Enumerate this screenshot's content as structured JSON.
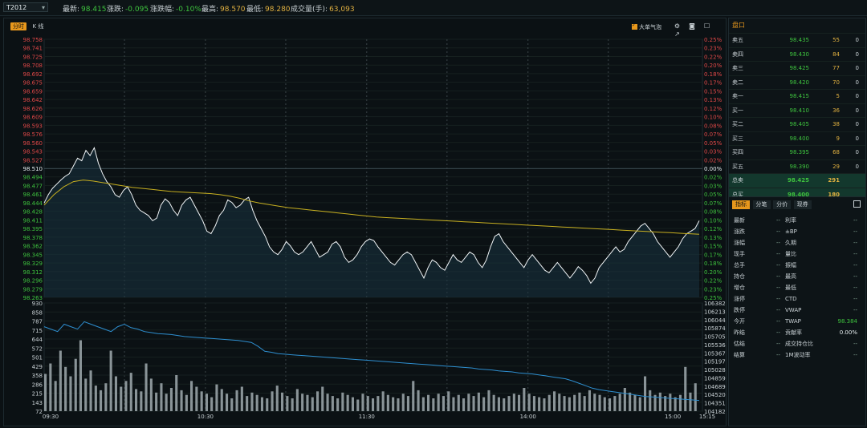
{
  "header": {
    "symbol": "T2012",
    "items": [
      {
        "label": "最新:",
        "value": "98.415",
        "color": "green"
      },
      {
        "label": "涨跌:",
        "value": "-0.095",
        "color": "green"
      },
      {
        "label": "涨跌幅:",
        "value": "-0.10%",
        "color": "green"
      },
      {
        "label": "最高:",
        "value": "98.570",
        "color": "yellow"
      },
      {
        "label": "最低:",
        "value": "98.280",
        "color": "yellow"
      },
      {
        "label": "成交量(手):",
        "value": "63,093",
        "color": "yellow"
      }
    ]
  },
  "chart_toolbar": {
    "tabs": [
      "分时",
      "K 线"
    ],
    "active_tab": 0,
    "bigorder_label": "大单气泡",
    "icons": [
      "gear-icon",
      "camera-icon",
      "square-icon",
      "external-link-icon"
    ]
  },
  "chart_data": {
    "type": "line",
    "ylim": [
      98.263,
      98.758
    ],
    "y_ticks": [
      "98.758",
      "98.741",
      "98.725",
      "98.708",
      "98.692",
      "98.675",
      "98.659",
      "98.642",
      "98.626",
      "98.609",
      "98.593",
      "98.576",
      "98.560",
      "98.543",
      "98.527",
      "98.510",
      "98.494",
      "98.477",
      "98.461",
      "98.444",
      "98.428",
      "98.411",
      "98.395",
      "98.378",
      "98.362",
      "98.345",
      "98.329",
      "98.312",
      "98.296",
      "98.279",
      "98.263"
    ],
    "right_pct_ticks": [
      "0.25%",
      "0.23%",
      "0.22%",
      "0.20%",
      "0.18%",
      "0.17%",
      "0.15%",
      "0.13%",
      "0.12%",
      "0.10%",
      "0.08%",
      "0.07%",
      "0.05%",
      "0.03%",
      "0.02%",
      "0.00%",
      "0.02%",
      "0.03%",
      "0.05%",
      "0.07%",
      "0.08%",
      "0.10%",
      "0.12%",
      "0.13%",
      "0.15%",
      "0.17%",
      "0.18%",
      "0.20%",
      "0.22%",
      "0.23%",
      "0.25%"
    ],
    "ref_price": 98.51,
    "x_labels": [
      "09:30",
      "10:30",
      "11:30",
      "14:00",
      "15:00",
      "15:15"
    ],
    "price_series": [
      98.444,
      98.46,
      98.472,
      98.48,
      98.488,
      98.495,
      98.5,
      98.515,
      98.53,
      98.525,
      98.545,
      98.535,
      98.55,
      98.52,
      98.5,
      98.485,
      98.475,
      98.46,
      98.455,
      98.468,
      98.475,
      98.46,
      98.44,
      98.43,
      98.425,
      98.42,
      98.41,
      98.415,
      98.44,
      98.452,
      98.445,
      98.43,
      98.42,
      98.44,
      98.45,
      98.455,
      98.44,
      98.425,
      98.41,
      98.39,
      98.385,
      98.4,
      98.42,
      98.43,
      98.45,
      98.445,
      98.435,
      98.44,
      98.45,
      98.455,
      98.43,
      98.41,
      98.395,
      98.38,
      98.36,
      98.35,
      98.345,
      98.355,
      98.37,
      98.362,
      98.35,
      98.345,
      98.35,
      98.36,
      98.37,
      98.355,
      98.34,
      98.345,
      98.35,
      98.365,
      98.37,
      98.36,
      98.34,
      98.33,
      98.335,
      98.345,
      98.36,
      98.37,
      98.375,
      98.372,
      98.36,
      98.35,
      98.34,
      98.33,
      98.325,
      98.335,
      98.345,
      98.35,
      98.345,
      98.33,
      98.315,
      98.3,
      98.32,
      98.335,
      98.33,
      98.32,
      98.315,
      98.33,
      98.345,
      98.335,
      98.33,
      98.34,
      98.35,
      98.345,
      98.33,
      98.32,
      98.335,
      98.36,
      98.38,
      98.385,
      98.37,
      98.36,
      98.35,
      98.34,
      98.33,
      98.32,
      98.335,
      98.345,
      98.335,
      98.325,
      98.315,
      98.31,
      98.32,
      98.33,
      98.32,
      98.31,
      98.3,
      98.31,
      98.322,
      98.315,
      98.305,
      98.29,
      98.3,
      98.32,
      98.33,
      98.34,
      98.35,
      98.36,
      98.35,
      98.355,
      98.37,
      98.38,
      98.39,
      98.4,
      98.405,
      98.395,
      98.385,
      98.37,
      98.36,
      98.35,
      98.34,
      98.35,
      98.36,
      98.375,
      98.385,
      98.39,
      98.395,
      98.41
    ],
    "avg_series": [
      98.44,
      98.46,
      98.475,
      98.485,
      98.488,
      98.486,
      98.483,
      98.48,
      98.477,
      98.474,
      98.472,
      98.47,
      98.468,
      98.466,
      98.465,
      98.464,
      98.463,
      98.462,
      98.46,
      98.457,
      98.453,
      98.448,
      98.444,
      98.441,
      98.438,
      98.435,
      98.433,
      98.431,
      98.429,
      98.427,
      98.425,
      98.423,
      98.421,
      98.419,
      98.417,
      98.416,
      98.415,
      98.414,
      98.413,
      98.412,
      98.411,
      98.41,
      98.409,
      98.408,
      98.407,
      98.406,
      98.405,
      98.404,
      98.403,
      98.402,
      98.401,
      98.4,
      98.399,
      98.398,
      98.397,
      98.396,
      98.395,
      98.394,
      98.393,
      98.392,
      98.391,
      98.39,
      98.389,
      98.388,
      98.387,
      98.386,
      98.385,
      98.384
    ],
    "volume_ylim": [
      72,
      930
    ],
    "volume_left_ticks": [
      "930",
      "858",
      "787",
      "715",
      "644",
      "572",
      "501",
      "429",
      "358",
      "286",
      "215",
      "143",
      "72"
    ],
    "volume_right_ticks": [
      "106382",
      "106213",
      "106044",
      "105874",
      "105705",
      "105536",
      "105367",
      "105197",
      "105028",
      "104859",
      "104689",
      "104520",
      "104351",
      "104182"
    ],
    "oi_series": [
      105900,
      105850,
      105800,
      105950,
      105900,
      105850,
      106000,
      105950,
      105900,
      105850,
      105800,
      105900,
      105950,
      105880,
      105850,
      105800,
      105780,
      105760,
      105750,
      105740,
      105720,
      105700,
      105690,
      105680,
      105670,
      105660,
      105650,
      105640,
      105630,
      105620,
      105600,
      105580,
      105500,
      105400,
      105380,
      105350,
      105340,
      105330,
      105320,
      105310,
      105300,
      105290,
      105280,
      105270,
      105260,
      105250,
      105240,
      105230,
      105220,
      105210,
      105200,
      105190,
      105180,
      105170,
      105160,
      105150,
      105140,
      105130,
      105120,
      105110,
      105100,
      105090,
      105080,
      105070,
      105060,
      105040,
      105030,
      105020,
      105000,
      104990,
      104980,
      104960,
      104950,
      104940,
      104920,
      104900,
      104880,
      104860,
      104840,
      104800,
      104750,
      104700,
      104650,
      104620,
      104600,
      104580,
      104560,
      104540,
      104520,
      104500,
      104480,
      104470,
      104460,
      104450,
      104440,
      104430,
      104420,
      104410,
      104400
    ],
    "volume_values": [
      320,
      410,
      260,
      520,
      380,
      300,
      450,
      610,
      280,
      350,
      220,
      180,
      240,
      520,
      300,
      210,
      260,
      330,
      190,
      170,
      410,
      280,
      160,
      240,
      150,
      200,
      310,
      180,
      140,
      260,
      210,
      170,
      150,
      120,
      230,
      190,
      150,
      110,
      180,
      210,
      130,
      160,
      140,
      120,
      110,
      170,
      220,
      160,
      130,
      110,
      190,
      150,
      140,
      120,
      170,
      210,
      150,
      130,
      110,
      160,
      140,
      120,
      100,
      150,
      130,
      110,
      130,
      170,
      140,
      120,
      110,
      150,
      130,
      260,
      180,
      120,
      140,
      110,
      150,
      130,
      170,
      120,
      140,
      110,
      150,
      130,
      160,
      120,
      180,
      140,
      120,
      110,
      130,
      150,
      140,
      200,
      150,
      130,
      120,
      110,
      140,
      170,
      150,
      130,
      120,
      140,
      160,
      130,
      180,
      150,
      140,
      120,
      110,
      130,
      150,
      200,
      160,
      140,
      120,
      300,
      180,
      140,
      160,
      130,
      150,
      120,
      140,
      380,
      160,
      240
    ]
  },
  "orderbook": {
    "title": "盘口",
    "rows": [
      {
        "label": "卖五",
        "price": "98.435",
        "qty": "55",
        "chg": "0"
      },
      {
        "label": "卖四",
        "price": "98.430",
        "qty": "84",
        "chg": "0"
      },
      {
        "label": "卖三",
        "price": "98.425",
        "qty": "77",
        "chg": "0"
      },
      {
        "label": "卖二",
        "price": "98.420",
        "qty": "70",
        "chg": "0"
      },
      {
        "label": "卖一",
        "price": "98.415",
        "qty": "5",
        "chg": "0"
      },
      {
        "label": "买一",
        "price": "98.410",
        "qty": "36",
        "chg": "0"
      },
      {
        "label": "买二",
        "price": "98.405",
        "qty": "38",
        "chg": "0"
      },
      {
        "label": "买三",
        "price": "98.400",
        "qty": "9",
        "chg": "0"
      },
      {
        "label": "买四",
        "price": "98.395",
        "qty": "68",
        "chg": "0"
      },
      {
        "label": "买五",
        "price": "98.390",
        "qty": "29",
        "chg": "0"
      }
    ],
    "totals": [
      {
        "label": "总卖",
        "price": "98.425",
        "qty": "291"
      },
      {
        "label": "总买",
        "price": "98.400",
        "qty": "180"
      }
    ]
  },
  "stats": {
    "tabs": [
      "指标",
      "分笔",
      "分价",
      "现券"
    ],
    "active_tab": 0,
    "rows": [
      {
        "l1": "最新",
        "v1": "--",
        "l2": "利率",
        "v2": "--"
      },
      {
        "l1": "涨跌",
        "v1": "--",
        "l2": "±BP",
        "v2": "--"
      },
      {
        "l1": "涨幅",
        "v1": "--",
        "l2": "久期",
        "v2": "--"
      },
      {
        "l1": "现手",
        "v1": "--",
        "l2": "量比",
        "v2": "--"
      },
      {
        "l1": "总手",
        "v1": "--",
        "l2": "振幅",
        "v2": "--"
      },
      {
        "l1": "持仓",
        "v1": "--",
        "l2": "最高",
        "v2": "--"
      },
      {
        "l1": "增仓",
        "v1": "--",
        "l2": "最低",
        "v2": "--"
      },
      {
        "l1": "涨停",
        "v1": "--",
        "l2": "CTD",
        "v2": "--"
      },
      {
        "l1": "跌停",
        "v1": "--",
        "l2": "VWAP",
        "v2": "--"
      },
      {
        "l1": "今开",
        "v1": "--",
        "l2": "TWAP",
        "v2": "98.384"
      },
      {
        "l1": "昨结",
        "v1": "--",
        "l2": "贡献率",
        "v2": "0.00%"
      },
      {
        "l1": "估结",
        "v1": "--",
        "l2": "成交持仓比",
        "v2": "--"
      },
      {
        "l1": "结算",
        "v1": "--",
        "l2": "1M波动率",
        "v2": "--"
      }
    ]
  }
}
